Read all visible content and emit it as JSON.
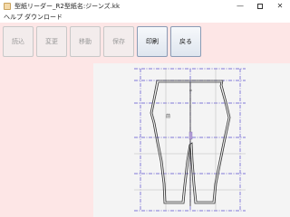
{
  "window": {
    "title": "型紙リーダー_R2型紙名:ジーンズ.kk",
    "minimize_glyph": "—",
    "close_glyph": "✕"
  },
  "menu": {
    "help": "ヘルプ",
    "download": "ダウンロード"
  },
  "toolbar": {
    "read": "読込",
    "change": "変更",
    "move": "移動",
    "save": "保存",
    "print": "印刷",
    "back": "戻る"
  },
  "pattern": {
    "piece_label": "前"
  },
  "colors": {
    "toolbar_bg": "#fde6e6",
    "canvas_bg": "#f4f4f4",
    "guide_line": "#5a4fcf",
    "pattern_line": "#333333"
  }
}
